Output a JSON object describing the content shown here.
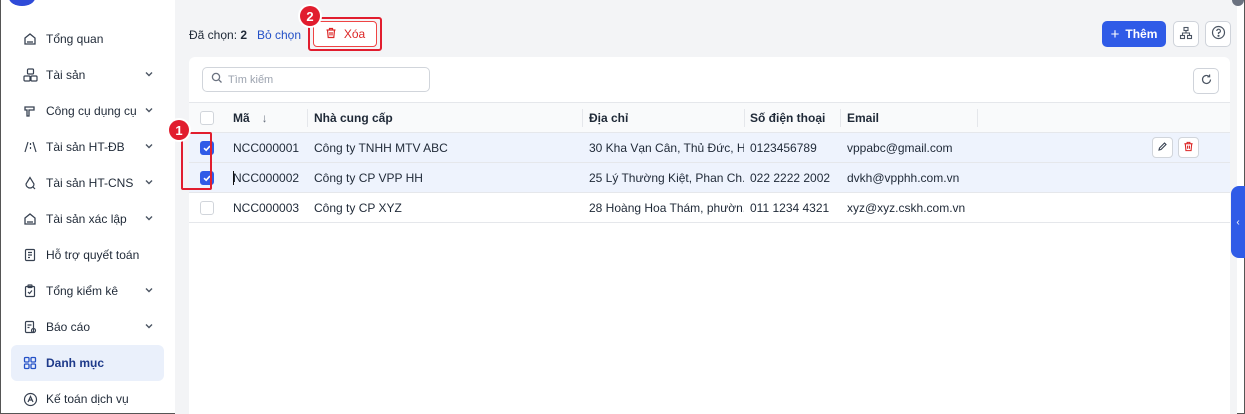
{
  "sidebar": {
    "items": [
      {
        "label": "Tổng quan",
        "icon": "home-icon",
        "has_chevron": false
      },
      {
        "label": "Tài sản",
        "icon": "assets-icon",
        "has_chevron": true
      },
      {
        "label": "Công cụ dụng cụ",
        "icon": "tools-icon",
        "has_chevron": true
      },
      {
        "label": "Tài sản HT-ĐB",
        "icon": "road-icon",
        "has_chevron": true
      },
      {
        "label": "Tài sản HT-CNS",
        "icon": "water-drop-icon",
        "has_chevron": true
      },
      {
        "label": "Tài sản xác lập",
        "icon": "building-icon",
        "has_chevron": true
      },
      {
        "label": "Hỗ trợ quyết toán",
        "icon": "document-icon",
        "has_chevron": false
      },
      {
        "label": "Tổng kiểm kê",
        "icon": "clipboard-icon",
        "has_chevron": true
      },
      {
        "label": "Báo cáo",
        "icon": "report-icon",
        "has_chevron": true
      },
      {
        "label": "Danh mục",
        "icon": "grid-icon",
        "has_chevron": false,
        "active": true
      },
      {
        "label": "Kế toán dịch vụ",
        "icon": "accounting-icon",
        "has_chevron": false
      }
    ]
  },
  "toolbar": {
    "selected_label": "Đã chọn:",
    "selected_count": "2",
    "unselect_label": "Bỏ chọn",
    "delete_label": "Xóa",
    "add_label": "Thêm",
    "badge_step2": "2"
  },
  "search": {
    "placeholder": "Tìm kiếm"
  },
  "table": {
    "columns": [
      "Mã",
      "Nhà cung cấp",
      "Địa chỉ",
      "Số điện thoại",
      "Email"
    ],
    "sort_indicator": "↓",
    "rows": [
      {
        "ma": "NCC000001",
        "ncc": "Công ty TNHH MTV ABC",
        "dia_chi": "30 Kha Vạn Cân, Thủ Đức, H...",
        "sdt": "0123456789",
        "email": "vppabc@gmail.com",
        "selected": true
      },
      {
        "ma": "NCC000002",
        "ncc": "Công ty CP VPP HH",
        "dia_chi": "25 Lý Thường Kiệt, Phan Ch...",
        "sdt": "022 2222 2002",
        "email": "dvkh@vpphh.com.vn",
        "selected": true
      },
      {
        "ma": "NCC000003",
        "ncc": "Công ty CP XYZ",
        "dia_chi": "28 Hoàng Hoa Thám, phườn...",
        "sdt": "011 1234 4321",
        "email": "xyz@xyz.cskh.com.vn",
        "selected": false
      }
    ]
  },
  "annotations": {
    "badge_step1": "1"
  },
  "colors": {
    "primary": "#2f5be7",
    "danger": "#e11d2e",
    "active_bg": "#eaf0fb"
  }
}
